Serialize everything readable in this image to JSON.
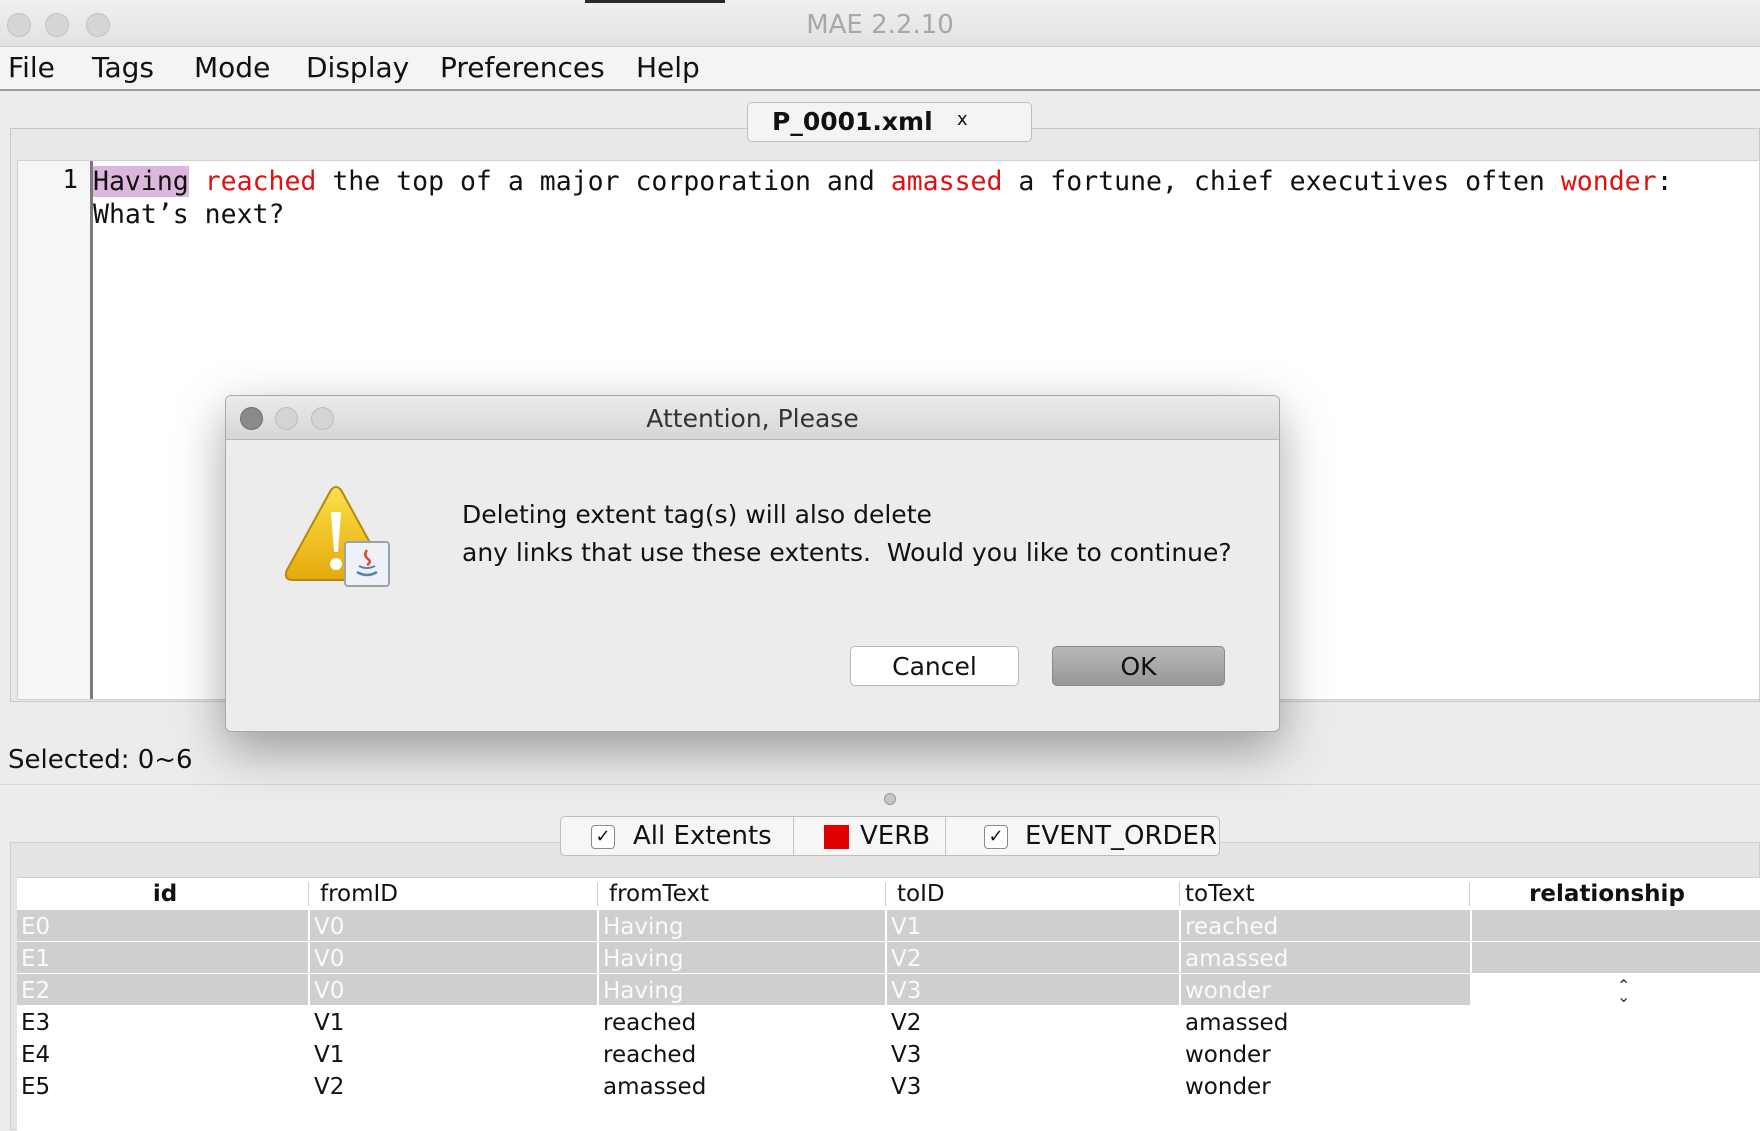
{
  "window": {
    "title": "MAE 2.2.10"
  },
  "menubar": {
    "items": [
      "File",
      "Tags",
      "Mode",
      "Display",
      "Preferences",
      "Help"
    ]
  },
  "editor": {
    "tab": {
      "label": "P_0001.xml",
      "close": "x"
    },
    "line_number": "1",
    "segments": [
      {
        "text": "Having",
        "style": "selected"
      },
      {
        "text": " ",
        "style": "plain"
      },
      {
        "text": "reached",
        "style": "verb"
      },
      {
        "text": " the top of a major corporation and ",
        "style": "plain"
      },
      {
        "text": "amassed",
        "style": "verb"
      },
      {
        "text": " a fortune, chief executives often ",
        "style": "plain"
      },
      {
        "text": "wonder",
        "style": "verb"
      },
      {
        "text": ":\nWhat’s next?",
        "style": "plain"
      }
    ]
  },
  "status": {
    "text": "Selected: 0~6"
  },
  "filters": [
    {
      "label": "All Extents",
      "kind": "checkbox",
      "checked": true
    },
    {
      "label": "VERB",
      "kind": "swatch",
      "color": "#e00000"
    },
    {
      "label": "EVENT_ORDER",
      "kind": "checkbox",
      "checked": true
    }
  ],
  "table": {
    "columns": [
      "id",
      "fromID",
      "fromText",
      "toID",
      "toText",
      "relationship"
    ],
    "rows": [
      {
        "cells": [
          "E0",
          "V0",
          "Having",
          "V1",
          "reached",
          ""
        ],
        "dim": true
      },
      {
        "cells": [
          "E1",
          "V0",
          "Having",
          "V2",
          "amassed",
          ""
        ],
        "dim": true
      },
      {
        "cells": [
          "E2",
          "V0",
          "Having",
          "V3",
          "wonder",
          ""
        ],
        "dim": true,
        "spinner": true
      },
      {
        "cells": [
          "E3",
          "V1",
          "reached",
          "V2",
          "amassed",
          ""
        ],
        "dim": false
      },
      {
        "cells": [
          "E4",
          "V1",
          "reached",
          "V3",
          "wonder",
          ""
        ],
        "dim": false
      },
      {
        "cells": [
          "E5",
          "V2",
          "amassed",
          "V3",
          "wonder",
          ""
        ],
        "dim": false
      }
    ]
  },
  "dialog": {
    "title": "Attention, Please",
    "message_line1": "Deleting extent tag(s) will also delete",
    "message_line2": "any links that use these extents.  Would you like to continue?",
    "cancel_label": "Cancel",
    "ok_label": "OK",
    "icon": "java-warning-icon"
  },
  "colors": {
    "verb_highlight": "#e01010",
    "selection": "#dcb6dc",
    "ok_button": "#a8a8a8"
  }
}
